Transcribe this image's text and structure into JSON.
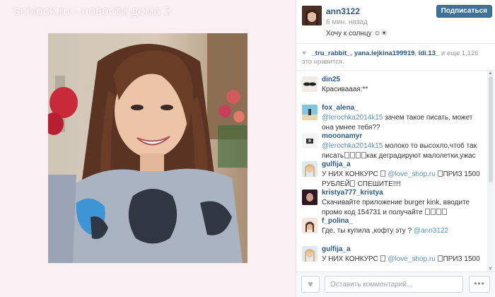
{
  "watermark": "schlock.ru - новости дома 2",
  "post": {
    "author": "ann3122",
    "time": "6 мин. назад",
    "caption": "Хочу к солнцу ☺☀",
    "follow_label": "Подписаться"
  },
  "likes": {
    "users": [
      "_tru_rabbit_",
      "yana.lejkina199919",
      "ldi.13_"
    ],
    "rest": "и еще 1,126 это нравится."
  },
  "comments": [
    {
      "user": "din25",
      "parts": [
        {
          "t": "Красивааая:**"
        }
      ]
    },
    {
      "user": "fox_alena_",
      "parts": [
        {
          "t": "@lerochka2014k15",
          "m": true
        },
        {
          "t": " зачем такое писать, может она умнее тебя??"
        }
      ]
    },
    {
      "user": "mooonamyr",
      "parts": [
        {
          "t": "@lerochka2014k15",
          "m": true
        },
        {
          "t": " молоко то высохло,чтоб так писать"
        },
        {
          "g": 4
        },
        {
          "t": "как деградируют малолетки,ужас"
        }
      ]
    },
    {
      "user": "gulfija_a",
      "parts": [
        {
          "t": "У НИХ КОНКУРС "
        },
        {
          "g": 1
        },
        {
          "t": " "
        },
        {
          "t": "@love_shop.ru",
          "m": true
        },
        {
          "t": " "
        },
        {
          "g": 1
        },
        {
          "t": "ПРИЗ 1500 РУБЛЕЙ"
        },
        {
          "g": 1
        },
        {
          "t": " СПЕШИТЕ!!!!"
        }
      ]
    },
    {
      "user": "kristya777_kristya",
      "parts": [
        {
          "t": "Скачивайте приложение burger kink, вводите промо код 154731 и получайте "
        },
        {
          "g": 4
        }
      ]
    },
    {
      "user": "f_polina_",
      "parts": [
        {
          "t": "Где, ты купила ,кофту эту ? "
        },
        {
          "t": "@ann3122",
          "m": true
        }
      ]
    },
    {
      "user": "gulfija_a",
      "parts": [
        {
          "t": "У НИХ КОНКУРС "
        },
        {
          "g": 1
        },
        {
          "t": " "
        },
        {
          "t": "@love_shop.ru",
          "m": true
        },
        {
          "t": " "
        },
        {
          "g": 1
        },
        {
          "t": "ПРИЗ 1500"
        }
      ]
    }
  ],
  "footer": {
    "comment_placeholder": "Оставить комментарий...",
    "more_label": "•••"
  },
  "colors": {
    "link": "#2c5a85",
    "mention": "#5a8fbf",
    "follow_button": "#3f729b"
  }
}
